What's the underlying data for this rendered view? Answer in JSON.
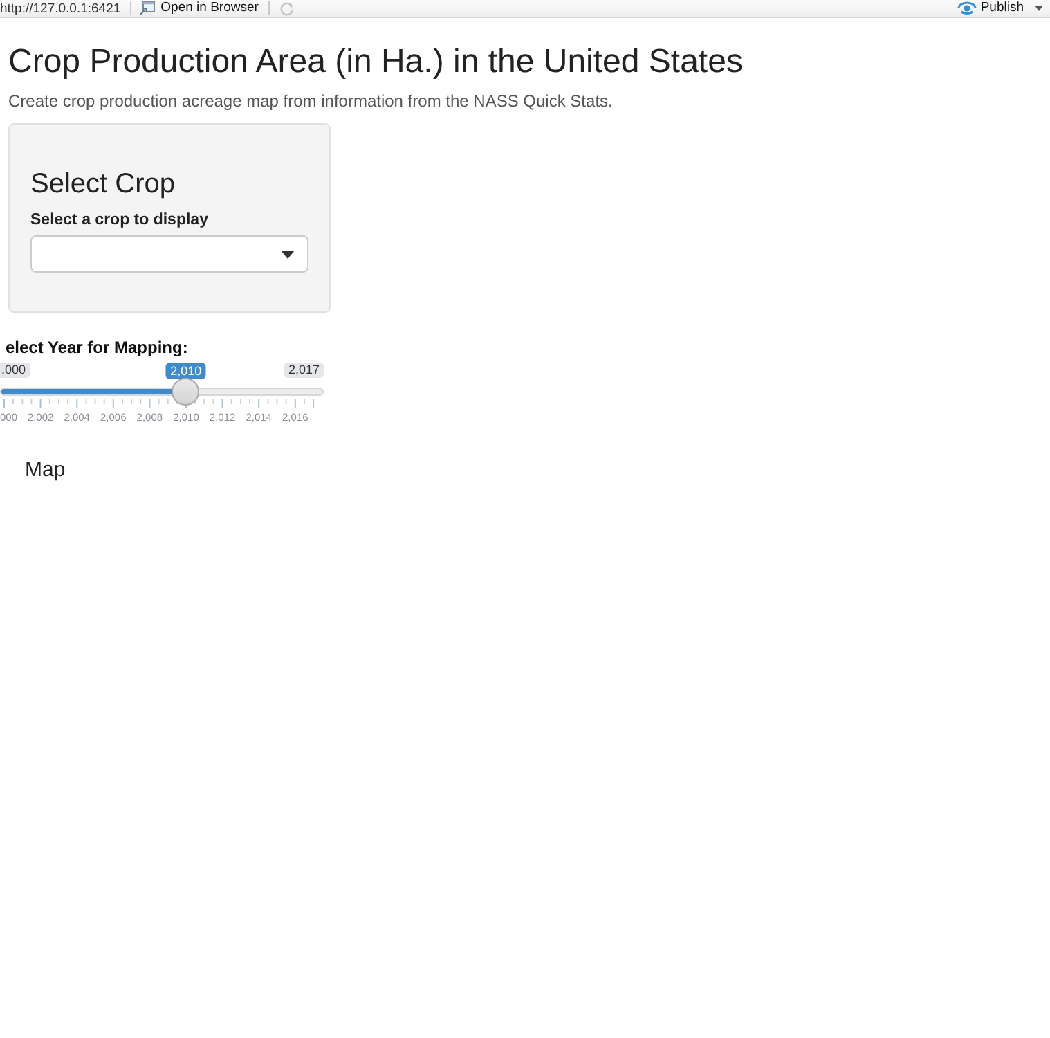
{
  "toolbar": {
    "url": "http://127.0.0.1:6421",
    "open_button": "Open in Browser",
    "refresh_button": {
      "disabled": true
    },
    "publish_button": "Publish"
  },
  "title": "Crop Production Area (in Ha.) in the United States",
  "subtitle": "Create crop production acreage map from information from the NASS Quick Stats.",
  "crop_panel": {
    "heading": "Select Crop",
    "label": "Select a crop to display"
  },
  "year_slider": {
    "label": "elect Year for Mapping:",
    "min_label": ",000",
    "value_label": "2,010",
    "max_label": "2,017",
    "level": 0.588,
    "tick_labels": [
      "000",
      "2,002",
      "2,004",
      "2,006",
      "2,008",
      "2,010",
      "2,012",
      "2,014",
      "2,016"
    ]
  },
  "map_section": {
    "heading": "Map"
  }
}
